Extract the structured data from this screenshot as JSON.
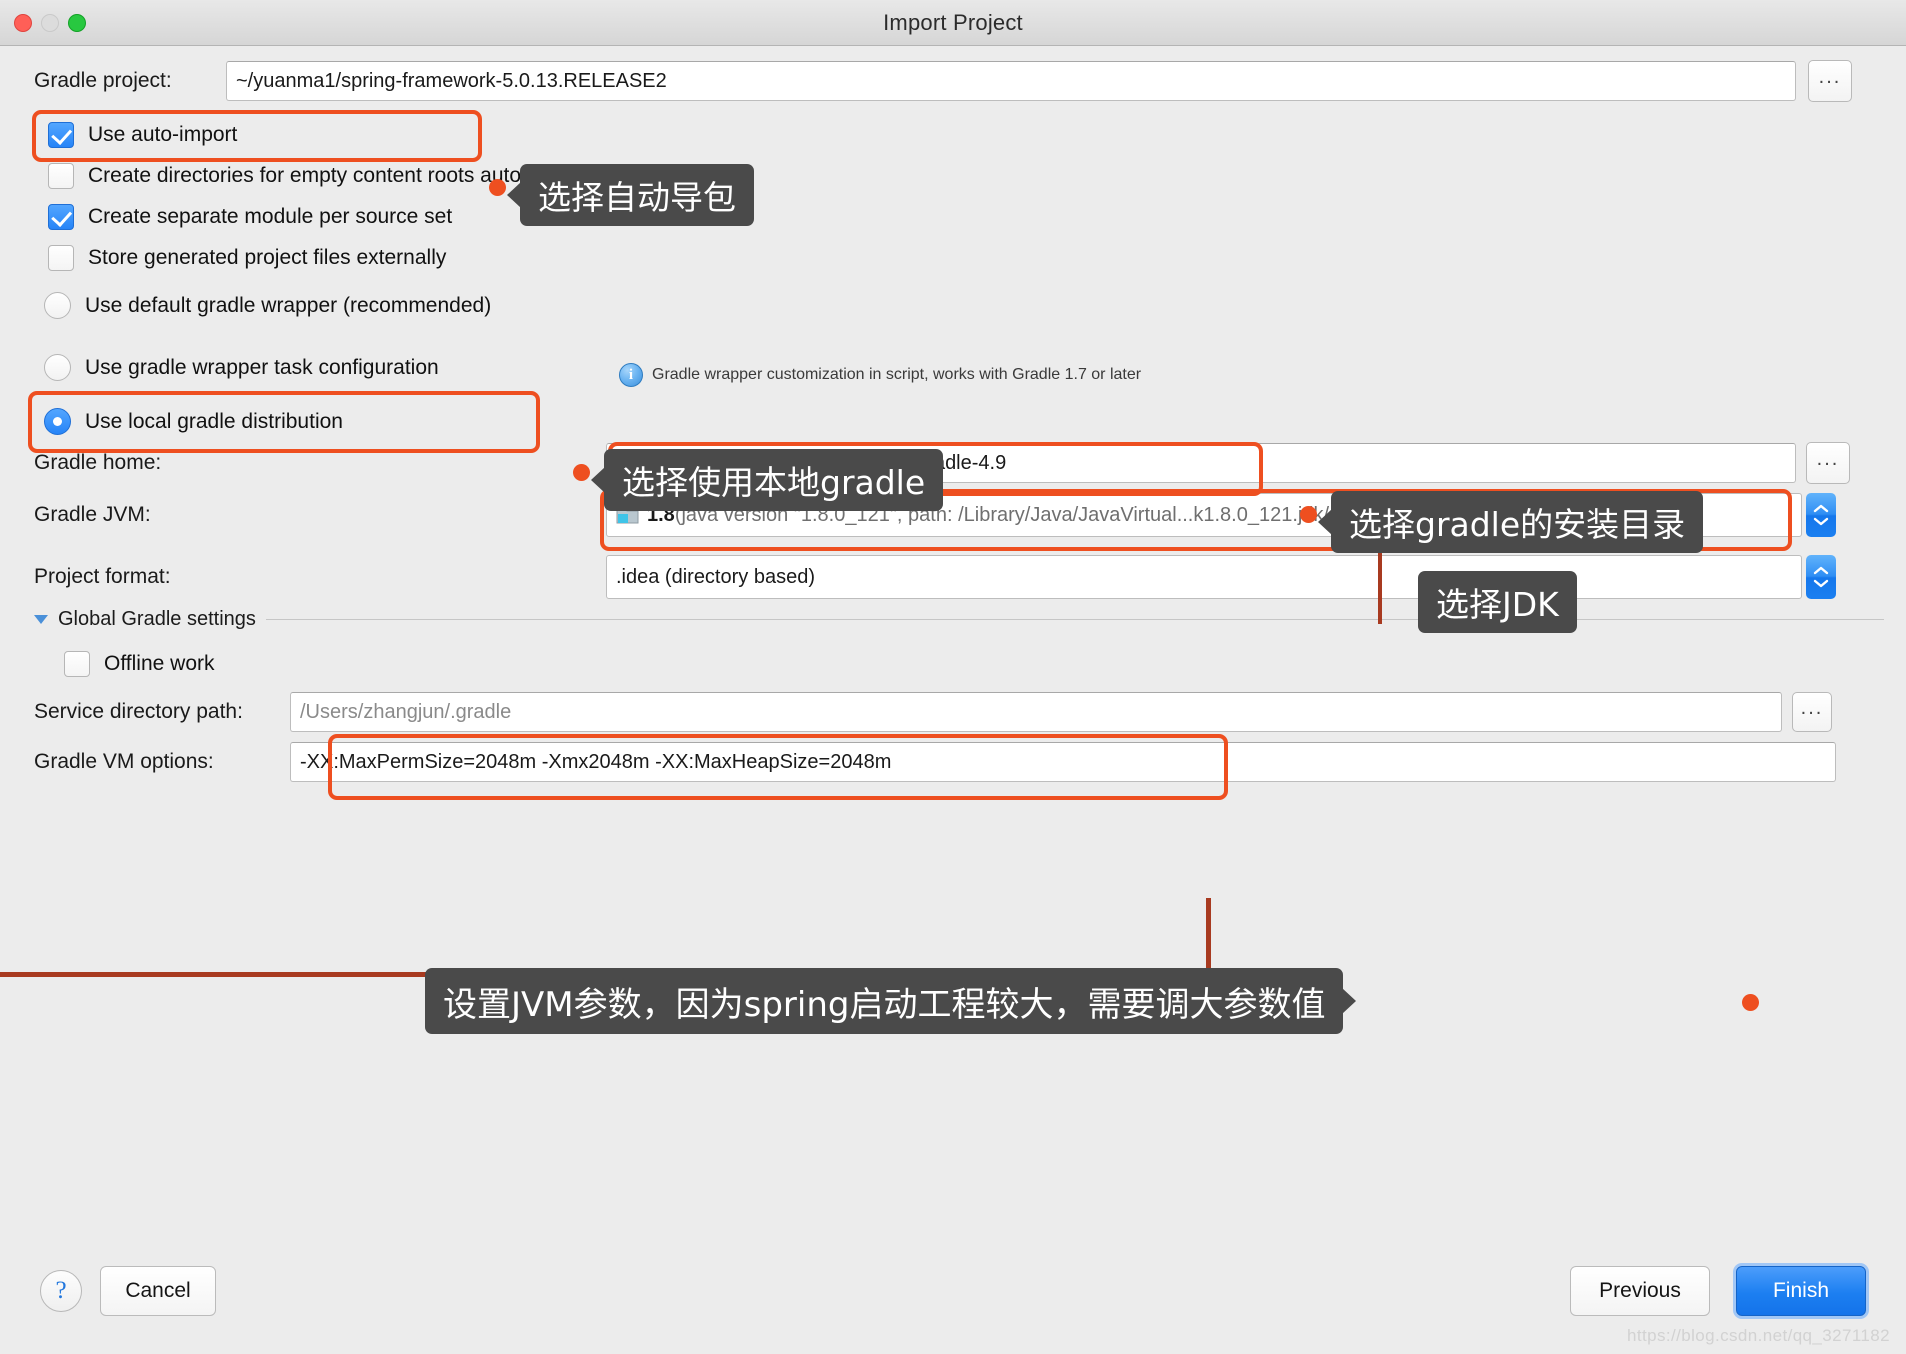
{
  "window": {
    "title": "Import Project",
    "traffic_lights": [
      "close-red",
      "minimize-grey",
      "zoom-green"
    ]
  },
  "form": {
    "gradle_project": {
      "label": "Gradle project:",
      "value": "~/yuanma1/spring-framework-5.0.13.RELEASE2",
      "browse_label": "..."
    },
    "options": [
      {
        "label": "Use auto-import",
        "type": "checkbox",
        "checked": true
      },
      {
        "label": "Create directories for empty content roots automatically",
        "type": "checkbox",
        "checked": false
      },
      {
        "label": "Create separate module per source set",
        "type": "checkbox",
        "checked": true
      },
      {
        "label": "Store generated project files externally",
        "type": "checkbox",
        "checked": false
      }
    ],
    "distribution": [
      {
        "label": "Use default gradle wrapper (recommended)",
        "type": "radio",
        "checked": false
      },
      {
        "label": "Use gradle wrapper task configuration",
        "type": "radio",
        "checked": false
      },
      {
        "label": "Use local gradle distribution",
        "type": "radio",
        "checked": true
      }
    ],
    "wrapper_hint": {
      "icon": "info-icon",
      "text": "Gradle wrapper customization in script, works with Gradle 1.7 or later"
    },
    "gradle_home": {
      "label": "Gradle home:",
      "value": "/Users/zhangjun/softinstall/gradle/gradle-4.9",
      "browse_label": "..."
    },
    "gradle_jvm": {
      "label": "Gradle JVM:",
      "value": "1.8 (java version \"1.8.0_121\", path: /Library/Java/JavaVirtual...k1.8.0_121.jdk/Contents/Home)",
      "value_prefix": "1.8",
      "value_rest": " (java version \"1.8.0_121\", path: /Library/Java/JavaVirtual...k1.8.0_121.jdk/Contents/Home)"
    },
    "project_format": {
      "label": "Project format:",
      "value": ".idea (directory based)"
    },
    "global_section": {
      "label": "Global Gradle settings",
      "expanded": true
    },
    "offline_work": {
      "label": "Offline work",
      "type": "checkbox",
      "checked": false
    },
    "service_directory": {
      "label": "Service directory path:",
      "value": "/Users/zhangjun/.gradle",
      "browse_label": "..."
    },
    "gradle_vm_options": {
      "label": "Gradle VM options:",
      "value": "-XX:MaxPermSize=2048m -Xmx2048m -XX:MaxHeapSize=2048m"
    }
  },
  "annotations": [
    {
      "id": "auto-import",
      "text": "选择自动导包"
    },
    {
      "id": "local-gradle",
      "text": "选择使用本地gradle"
    },
    {
      "id": "gradle-dir",
      "text": "选择gradle的安装目录"
    },
    {
      "id": "select-jdk",
      "text": "选择JDK"
    },
    {
      "id": "vm-options",
      "text": "设置JVM参数，因为spring启动工程较大，需要调大参数值"
    }
  ],
  "footer": {
    "help_label": "?",
    "cancel_label": "Cancel",
    "previous_label": "Previous",
    "finish_label": "Finish"
  },
  "watermark": "https://blog.csdn.net/qq_3271182",
  "colors": {
    "accent_orange": "#ee4f20",
    "primary_blue": "#1c7ff1",
    "tooltip_bg": "#4a4a4a",
    "window_bg": "#ececec"
  }
}
